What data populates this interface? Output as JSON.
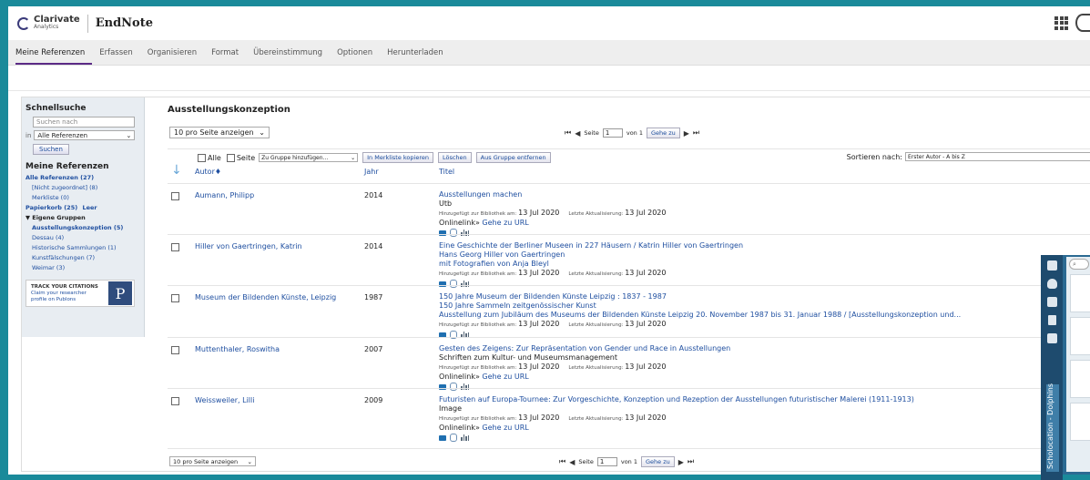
{
  "header": {
    "brand_top": "Clarivate",
    "brand_bottom": "Analytics",
    "app_name": "EndNote"
  },
  "nav": {
    "items": [
      "Meine Referenzen",
      "Erfassen",
      "Organisieren",
      "Format",
      "Übereinstimmung",
      "Optionen",
      "Herunterladen"
    ],
    "active_index": 0
  },
  "sidebar": {
    "quick_search_title": "Schnellsuche",
    "search_placeholder": "Suchen nach",
    "in_label": "in",
    "scope_value": "Alle Referenzen",
    "search_button": "Suchen",
    "my_refs_title": "Meine Referenzen",
    "all_refs": "Alle Referenzen (27)",
    "unfiled": "[Nicht zugeordnet] (8)",
    "quick_list": "Merkliste (0)",
    "trash": "Papierkorb (25)",
    "empty": "Leer",
    "own_groups": "▼ Eigene Gruppen",
    "groups": [
      "Ausstellungskonzeption (5)",
      "Dessau (4)",
      "Historische Sammlungen (1)",
      "Kunstfälschungen (7)",
      "Weimar (3)"
    ],
    "publons_line1": "TRACK YOUR CITATIONS",
    "publons_line2": "Claim your researcher",
    "publons_line3": "profile on Publons",
    "publons_logo": "P"
  },
  "main": {
    "title": "Ausstellungskonzeption",
    "per_page": "10 pro Seite anzeigen",
    "page_label": "Seite",
    "page_value": "1",
    "of_label": "von 1",
    "goto_button": "Gehe zu",
    "all_label": "Alle",
    "page_cb_label": "Seite",
    "group_select": "Zu Gruppe hinzufügen...",
    "copy_button": "In Merkliste kopieren",
    "delete_button": "Löschen",
    "remove_button": "Aus Gruppe entfernen",
    "sort_label": "Sortieren nach:",
    "sort_value": "Erster Autor - A bis Z",
    "col_author": "Autor♦",
    "col_year": "Jahr",
    "col_title": "Titel",
    "added_label": "Hinzugefügt zur Bibliothek am:",
    "updated_label": "Letzte Aktualisierung:",
    "online_label": "Onlinelink»",
    "goto_url": "Gehe zu URL"
  },
  "references": [
    {
      "author": "Aumann, Philipp",
      "year": "2014",
      "title_lines": [
        "Ausstellungen machen"
      ],
      "sub_lines": [
        "Utb"
      ],
      "added": "13 Jul 2020",
      "updated": "13 Jul 2020",
      "online": true
    },
    {
      "author": "Hiller von Gaertringen, Katrin",
      "year": "2014",
      "title_lines": [
        "Eine Geschichte der Berliner Museen in 227 Häusern / Katrin Hiller von Gaertringen",
        "Hans Georg Hiller von Gaertringen",
        "mit Fotografien von Anja Bleyl"
      ],
      "sub_lines": [],
      "added": "13 Jul 2020",
      "updated": "13 Jul 2020",
      "online": false
    },
    {
      "author": "Museum der Bildenden Künste, Leipzig",
      "year": "1987",
      "title_lines": [
        "150 Jahre Museum der Bildenden Künste Leipzig : 1837 - 1987",
        "150 Jahre Sammeln zeitgenössischer Kunst",
        "Ausstellung zum Jubiläum des Museums der Bildenden Künste Leipzig 20. November 1987 bis 31. Januar 1988 / [Ausstellungskonzeption und..."
      ],
      "sub_lines": [],
      "added": "13 Jul 2020",
      "updated": "13 Jul 2020",
      "online": false
    },
    {
      "author": "Muttenthaler, Roswitha",
      "year": "2007",
      "title_lines": [
        "Gesten des Zeigens: Zur Repräsentation von Gender und Race in Ausstellungen"
      ],
      "sub_lines": [
        "Schriften zum Kultur- und Museumsmanagement"
      ],
      "added": "13 Jul 2020",
      "updated": "13 Jul 2020",
      "online": true
    },
    {
      "author": "Weissweiler, Lilli",
      "year": "2009",
      "title_lines": [
        "Futuristen auf Europa-Tournee: Zur Vorgeschichte, Konzeption und Rezeption der Ausstellungen futuristischer Malerei (1911-1913)"
      ],
      "sub_lines": [
        "Image"
      ],
      "added": "13 Jul 2020",
      "updated": "13 Jul 2020",
      "online": true
    }
  ],
  "side_panel": {
    "vertical_label": "Scholocation - Dolphins"
  },
  "colors": {
    "accent": "#5b2a86",
    "link": "#1f4fa0",
    "frame": "#1a8a9a"
  }
}
